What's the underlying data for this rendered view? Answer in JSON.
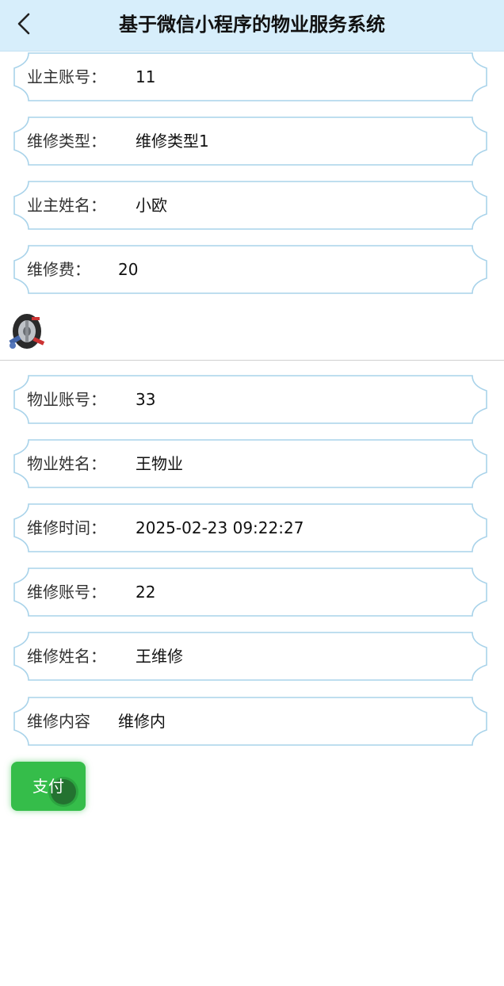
{
  "header": {
    "title": "基于微信小程序的物业服务系统",
    "back_icon": "chevron-left-icon"
  },
  "fields_top": [
    {
      "label": "业主账号：",
      "value": "11"
    },
    {
      "label": "维修类型：",
      "value": "维修类型1"
    },
    {
      "label": "业主姓名：",
      "value": "小欧"
    },
    {
      "label": "维修费：",
      "value": "20"
    }
  ],
  "image": {
    "icon": "car-wheel-tools-image"
  },
  "fields_bottom": [
    {
      "label": "物业账号：",
      "value": "33"
    },
    {
      "label": "物业姓名：",
      "value": "王物业"
    },
    {
      "label": "维修时间：",
      "value": "2025-02-23 09:22:27"
    },
    {
      "label": "维修账号：",
      "value": "22"
    },
    {
      "label": "维修姓名：",
      "value": "王维修"
    },
    {
      "label": "维修内容",
      "value": "维修内"
    }
  ],
  "actions": {
    "pay_label": "支付"
  },
  "colors": {
    "header_bg": "#d7eefb",
    "card_border": "#a9d3ea",
    "pay_button": "#35bd4a"
  }
}
